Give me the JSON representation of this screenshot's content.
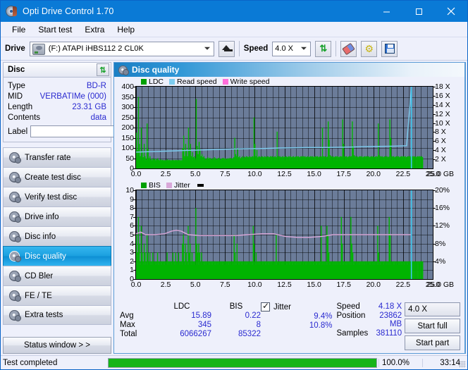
{
  "window": {
    "title": "Opti Drive Control 1.70",
    "icon": "disc-icon",
    "minimize": "–",
    "maximize": "□",
    "close": "✕"
  },
  "menu": {
    "items": [
      "File",
      "Start test",
      "Extra",
      "Help"
    ]
  },
  "toolbar": {
    "drive_label": "Drive",
    "drive_value": "(F:)  ATAPI iHBS112  2 CL0K",
    "eject_icon": "eject-icon",
    "speed_label": "Speed",
    "speed_value": "4.0 X",
    "refresh_icon": "refresh-icon",
    "eraser_icon": "eraser-icon",
    "wrench_icon": "wrench-icon",
    "save_icon": "save-icon"
  },
  "disc_panel": {
    "title": "Disc",
    "refresh_icon": "refresh-icon",
    "rows": [
      {
        "key": "Type",
        "value": "BD-R"
      },
      {
        "key": "MID",
        "value": "VERBATIMe (000)"
      },
      {
        "key": "Length",
        "value": "23.31 GB"
      },
      {
        "key": "Contents",
        "value": "data"
      }
    ],
    "label_key": "Label",
    "label_value": "",
    "label_placeholder": "",
    "disc_button_icon": "cd-icon"
  },
  "sidebar": {
    "items": [
      {
        "label": "Transfer rate",
        "icon": "disc-icon",
        "active": false
      },
      {
        "label": "Create test disc",
        "icon": "disc-icon",
        "active": false
      },
      {
        "label": "Verify test disc",
        "icon": "disc-icon",
        "active": false
      },
      {
        "label": "Drive info",
        "icon": "disc-icon",
        "active": false
      },
      {
        "label": "Disc info",
        "icon": "disc-icon",
        "active": false
      },
      {
        "label": "Disc quality",
        "icon": "disc-icon",
        "active": true
      },
      {
        "label": "CD Bler",
        "icon": "disc-icon",
        "active": false
      },
      {
        "label": "FE / TE",
        "icon": "disc-icon",
        "active": false
      },
      {
        "label": "Extra tests",
        "icon": "disc-icon",
        "active": false
      }
    ],
    "status_window_button": "Status window > >"
  },
  "main": {
    "header_title": "Disc quality",
    "header_icon": "disc-icon"
  },
  "chart_data": [
    {
      "id": "ldc-chart",
      "type": "line",
      "title": "",
      "xlabel": "25.0 GB",
      "ylabel": "",
      "ylim": [
        0,
        400
      ],
      "yticks": [
        0,
        50,
        100,
        150,
        200,
        250,
        300,
        350,
        400
      ],
      "y2lim": [
        0,
        18
      ],
      "y2ticks": [
        "2 X",
        "4 X",
        "6 X",
        "8 X",
        "10 X",
        "12 X",
        "14 X",
        "16 X",
        "18 X"
      ],
      "xlim": [
        0,
        25
      ],
      "xticks": [
        "0.0",
        "2.5",
        "5.0",
        "7.5",
        "10.0",
        "12.5",
        "15.0",
        "17.5",
        "20.0",
        "22.5",
        "25.0"
      ],
      "grid": true,
      "legend_position": "top-left",
      "legend": [
        {
          "name": "LDC",
          "color": "#00b400"
        },
        {
          "name": "Read speed",
          "color": "#7ecdf0"
        },
        {
          "name": "Write speed",
          "color": "#ff6ddb"
        }
      ],
      "series": [
        {
          "name": "LDC",
          "kind": "spike-area",
          "color": "#00b400",
          "values": [
            175,
            90,
            350,
            120,
            60,
            200,
            80,
            55,
            120,
            60,
            45,
            220,
            95,
            50,
            60,
            45,
            40,
            50,
            45,
            48,
            40,
            45,
            50,
            42,
            40,
            45,
            40,
            42,
            38,
            40,
            38,
            40,
            45,
            40,
            42,
            40,
            38,
            40,
            42,
            38,
            40,
            42,
            40,
            38,
            42,
            40,
            38,
            40,
            100,
            160,
            60,
            120,
            90,
            60,
            200,
            95,
            120,
            60,
            80,
            55,
            60,
            50,
            340,
            110,
            70,
            130,
            95,
            60,
            70,
            55,
            60,
            50,
            45,
            50,
            55,
            48,
            52,
            50,
            45,
            50,
            48,
            55,
            50,
            45,
            48,
            52,
            50,
            45,
            48,
            50,
            52,
            48,
            50,
            45,
            48,
            50,
            48,
            52,
            50,
            48,
            50,
            55,
            150,
            70,
            60,
            100,
            55,
            60,
            50,
            55,
            60,
            52,
            58,
            55,
            60,
            58,
            55,
            60,
            58,
            55,
            60,
            58,
            250,
            120,
            60,
            90,
            55,
            60,
            58,
            55,
            60,
            58,
            55,
            60,
            58,
            55,
            60,
            58,
            55,
            60,
            58,
            60,
            55,
            58,
            60,
            55,
            180,
            60,
            58,
            60,
            55,
            58,
            60,
            55,
            58,
            60,
            58,
            55,
            60,
            58,
            60,
            55,
            58,
            60,
            55,
            58,
            60,
            58,
            60,
            55,
            58,
            60,
            58,
            60,
            58,
            60,
            55,
            58,
            60,
            55,
            58,
            60,
            58,
            60,
            55,
            58,
            60,
            58,
            60,
            55,
            58,
            60,
            58,
            200,
            60,
            58,
            60,
            55,
            58,
            230,
            140,
            65,
            60,
            58,
            60,
            55,
            58,
            60,
            58,
            60,
            55,
            58,
            60,
            58,
            240,
            120,
            60,
            58,
            60,
            55,
            58,
            60,
            58,
            60,
            230,
            110,
            65,
            60,
            58,
            60,
            55,
            58,
            60,
            58,
            60,
            55,
            58,
            60,
            58,
            60,
            58,
            60,
            55,
            58,
            60,
            58,
            60,
            55,
            58,
            60,
            58,
            220,
            65,
            60,
            58,
            60,
            55,
            58,
            60,
            58,
            60,
            55,
            58,
            240,
            150,
            60,
            58,
            60,
            55,
            58,
            60,
            58,
            60,
            55,
            58,
            60,
            58,
            60,
            58,
            60,
            55,
            58,
            60,
            58,
            60,
            55,
            58,
            60,
            58,
            60,
            55,
            58,
            60,
            58,
            60,
            58,
            60,
            55,
            0,
            0,
            0,
            0,
            0,
            0,
            0,
            0,
            0,
            0
          ]
        },
        {
          "name": "Read speed",
          "kind": "line",
          "color": "#7ecdf0",
          "values_x": [
            0.0,
            1.2,
            2.4,
            3.6,
            4.8,
            6.0,
            7.2,
            8.4,
            9.6,
            10.8,
            12.0,
            13.2,
            14.4,
            15.6,
            16.8,
            18.0,
            19.2,
            20.4,
            21.6,
            22.8,
            23.2
          ],
          "values_y": [
            3.6,
            3.7,
            3.8,
            3.9,
            4.0,
            4.1,
            4.2,
            4.3,
            4.35,
            4.4,
            4.5,
            4.55,
            4.6,
            4.6,
            4.65,
            4.7,
            4.8,
            4.85,
            4.9,
            5.0,
            18.0
          ]
        }
      ],
      "marker_line": {
        "x": 23.2,
        "color": "#3fc8ef"
      }
    },
    {
      "id": "bis-jitter-chart",
      "type": "line",
      "title": "",
      "xlabel": "25.0 GB",
      "ylabel": "",
      "ylim": [
        0,
        10
      ],
      "yticks": [
        0,
        1,
        2,
        3,
        4,
        5,
        6,
        7,
        8,
        9,
        10
      ],
      "y2lim": [
        0,
        20
      ],
      "y2ticks": [
        "4%",
        "8%",
        "12%",
        "16%",
        "20%"
      ],
      "xlim": [
        0,
        25
      ],
      "xticks": [
        "0.0",
        "2.5",
        "5.0",
        "7.5",
        "10.0",
        "12.5",
        "15.0",
        "17.5",
        "20.0",
        "22.5",
        "25.0"
      ],
      "grid": true,
      "legend_position": "top-left",
      "legend": [
        {
          "name": "BIS",
          "color": "#00b400"
        },
        {
          "name": "Jitter",
          "color": "#d9a8d9"
        }
      ],
      "series": [
        {
          "name": "BIS",
          "kind": "spike-area",
          "color": "#00b400",
          "values": [
            5,
            3,
            7,
            4,
            2,
            6,
            3,
            2,
            4,
            3,
            2,
            5,
            3,
            2,
            3,
            2,
            2,
            3,
            2,
            2,
            2,
            2,
            3,
            2,
            2,
            2,
            2,
            2,
            2,
            2,
            2,
            2,
            3,
            2,
            2,
            2,
            2,
            2,
            3,
            2,
            2,
            3,
            2,
            2,
            3,
            2,
            2,
            2,
            4,
            5,
            2,
            4,
            3,
            2,
            6,
            3,
            4,
            2,
            3,
            2,
            2,
            2,
            8,
            4,
            3,
            4,
            3,
            2,
            3,
            2,
            2,
            2,
            2,
            2,
            2,
            2,
            2,
            2,
            2,
            2,
            2,
            2,
            2,
            2,
            2,
            2,
            2,
            2,
            2,
            2,
            2,
            2,
            2,
            2,
            2,
            2,
            2,
            2,
            2,
            2,
            2,
            2,
            5,
            3,
            2,
            4,
            2,
            2,
            2,
            2,
            2,
            2,
            2,
            2,
            2,
            2,
            2,
            2,
            2,
            2,
            2,
            2,
            6,
            4,
            2,
            3,
            2,
            2,
            2,
            2,
            2,
            2,
            2,
            2,
            2,
            2,
            2,
            2,
            2,
            2,
            2,
            2,
            2,
            2,
            2,
            2,
            5,
            2,
            2,
            2,
            2,
            2,
            2,
            2,
            2,
            2,
            2,
            2,
            2,
            2,
            2,
            2,
            2,
            2,
            2,
            2,
            2,
            2,
            2,
            2,
            2,
            2,
            2,
            2,
            2,
            2,
            2,
            2,
            2,
            2,
            2,
            2,
            2,
            2,
            2,
            2,
            2,
            2,
            2,
            2,
            2,
            2,
            2,
            6,
            2,
            2,
            2,
            2,
            2,
            6,
            5,
            3,
            2,
            2,
            2,
            2,
            2,
            2,
            2,
            2,
            2,
            2,
            2,
            2,
            7,
            4,
            2,
            2,
            2,
            2,
            2,
            2,
            2,
            2,
            7,
            4,
            3,
            2,
            2,
            2,
            2,
            2,
            2,
            2,
            2,
            2,
            2,
            2,
            2,
            2,
            2,
            2,
            2,
            2,
            2,
            2,
            2,
            2,
            2,
            2,
            2,
            2,
            6,
            3,
            2,
            2,
            2,
            2,
            2,
            2,
            2,
            2,
            2,
            2,
            7,
            5,
            2,
            2,
            2,
            2,
            2,
            2,
            2,
            2,
            2,
            2,
            2,
            2,
            2,
            2,
            2,
            2,
            2,
            2,
            2,
            2,
            2,
            2,
            2,
            2,
            2,
            2,
            2,
            2,
            2,
            2,
            2,
            2,
            2,
            2,
            0,
            0,
            0,
            0,
            0,
            0,
            0,
            0,
            0,
            0
          ]
        },
        {
          "name": "Jitter",
          "kind": "line",
          "color": "#d9a8d9",
          "values_x": [
            0.0,
            0.4,
            0.8,
            1.6,
            2.4,
            3.0,
            3.4,
            3.8,
            4.4,
            5.4,
            6.4,
            7.4,
            8.4,
            9.4,
            10.6,
            11.6,
            12.6,
            13.6,
            14.6,
            15.6,
            16.6,
            17.6,
            18.6,
            19.6,
            20.6,
            21.6,
            22.6,
            23.2
          ],
          "values_y": [
            5.1,
            5.3,
            5.0,
            5.0,
            5.1,
            5.4,
            5.5,
            5.4,
            5.0,
            4.9,
            4.9,
            4.9,
            4.9,
            5.0,
            5.1,
            5.1,
            4.8,
            4.7,
            4.7,
            4.8,
            5.0,
            5.0,
            5.0,
            5.0,
            5.0,
            5.0,
            5.0,
            5.0
          ]
        }
      ],
      "marker_line": {
        "x": 23.2,
        "color": "#3fc8ef"
      }
    }
  ],
  "stats": {
    "col_headers": [
      "LDC",
      "BIS"
    ],
    "rows": [
      {
        "label": "Avg",
        "ldc": "15.89",
        "bis": "0.22"
      },
      {
        "label": "Max",
        "ldc": "345",
        "bis": "8"
      },
      {
        "label": "Total",
        "ldc": "6066267",
        "bis": "85322"
      }
    ],
    "jitter_label": "Jitter",
    "jitter_checked": true,
    "jitter_avg": "9.4%",
    "jitter_max": "10.8%",
    "speed_label": "Speed",
    "speed_value": "4.18 X",
    "position_label": "Position",
    "position_value": "23862 MB",
    "samples_label": "Samples",
    "samples_value": "381110",
    "speed_select": "4.0 X",
    "start_full_button": "Start full",
    "start_part_button": "Start part"
  },
  "statusbar": {
    "message": "Test completed",
    "progress_percent": 100.0,
    "progress_text": "100.0%",
    "elapsed": "33:14"
  },
  "colors": {
    "accent": "#0a7ad6",
    "value_blue": "#2a2ad0",
    "green": "#00b400",
    "read_speed": "#7ecdf0",
    "write_speed": "#ff6ddb",
    "jitter": "#d9a8d9",
    "plot_bg": "#6b7c99",
    "progress": "#16b418"
  }
}
